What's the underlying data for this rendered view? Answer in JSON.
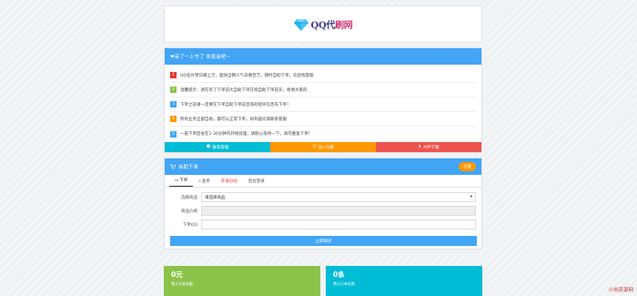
{
  "logo": {
    "text_main": "QQ代",
    "text_tail": "刷网"
  },
  "notice": {
    "title": "❤亲了一上午了 休息会吧~",
    "items": [
      {
        "num": "1",
        "color": "#e53935",
        "text": "QQ名片赞日赠上万，超快全网人气日赠百万，随时自助下单，欢迎找客服"
      },
      {
        "num": "2",
        "color": "#8bc34a",
        "text": "温馨提示：请在有了下单前大自助下单在找自助下单前买，谢谢大家的"
      },
      {
        "num": "3",
        "color": "#42a5f5",
        "text": "下单之前请一定要在下单自助下单前咨询的指导信息先下单！"
      },
      {
        "num": "4",
        "color": "#ff9800",
        "text": "所有业务全部自助，都可以正常下单，如有疑问请联系客服"
      },
      {
        "num": "5",
        "color": "#42a5f5",
        "text": "一般下单后会在1-30分钟内开始处理，请耐心等待一下，请勿重复下单！"
      }
    ],
    "links": [
      {
        "label": "联系客服",
        "color": "#00bcd4",
        "icon": "user-icon"
      },
      {
        "label": "加入Q群",
        "color": "#ff9800",
        "icon": "group-icon"
      },
      {
        "label": "APP下载",
        "color": "#ef5350",
        "icon": "download-icon"
      }
    ]
  },
  "order": {
    "title": "自助下单",
    "help_label": "注意",
    "tabs": [
      {
        "label": "下单",
        "icon": "cart-icon",
        "style": "active"
      },
      {
        "label": "查单",
        "icon": "search-icon",
        "style": ""
      },
      {
        "label": "开通分站",
        "icon": "",
        "style": "red"
      },
      {
        "label": "后台登录",
        "icon": "",
        "style": ""
      }
    ],
    "fields": {
      "product_label": "选择商品",
      "product_value": "请选择商品",
      "price_label": "商品价格",
      "price_value": "",
      "qq_label": "下单QQ",
      "qq_value": ""
    },
    "submit_label": "立即购买"
  },
  "stats": [
    {
      "value": "0元",
      "label": "累计交易金额",
      "color": "#8bc34a"
    },
    {
      "value": "0条",
      "label": "累计订单总数",
      "color": "#00bcd4"
    }
  ],
  "watermark": "小刘资源网"
}
